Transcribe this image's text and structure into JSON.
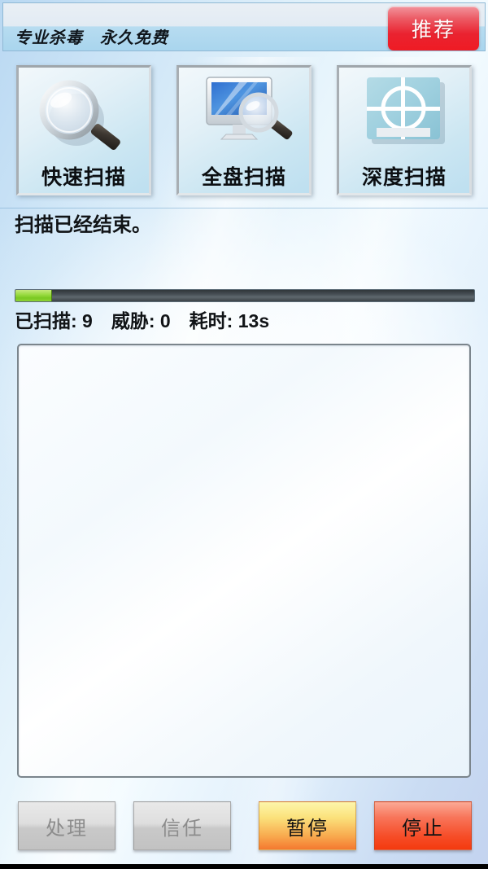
{
  "header": {
    "title": "专业杀毒　永久免费",
    "recommend_label": "推荐",
    "recommend_color": "#ea2330"
  },
  "scan_buttons": [
    {
      "label": "快速扫描",
      "icon": "magnifier-icon"
    },
    {
      "label": "全盘扫描",
      "icon": "monitor-magnifier-icon"
    },
    {
      "label": "深度扫描",
      "icon": "crosshair-target-icon"
    }
  ],
  "status": {
    "message": "扫描已经结束。",
    "stats_line": "已扫描: 9　威胁: 0　耗时: 13s",
    "scanned_label": "已扫描",
    "scanned_value": "9",
    "threats_label": "威胁",
    "threats_value": "0",
    "elapsed_label": "耗时",
    "elapsed_value": "13s"
  },
  "progress": {
    "percent": 8,
    "fill_width": "8%",
    "fill_color": "#8ed334",
    "track_color": "#4a5258"
  },
  "result_list": {
    "items": [],
    "empty_text": ""
  },
  "actions": [
    {
      "label": "处理",
      "state": "disabled"
    },
    {
      "label": "信任",
      "state": "disabled"
    },
    {
      "label": "暂停",
      "state": "warn"
    },
    {
      "label": "停止",
      "state": "danger"
    }
  ]
}
